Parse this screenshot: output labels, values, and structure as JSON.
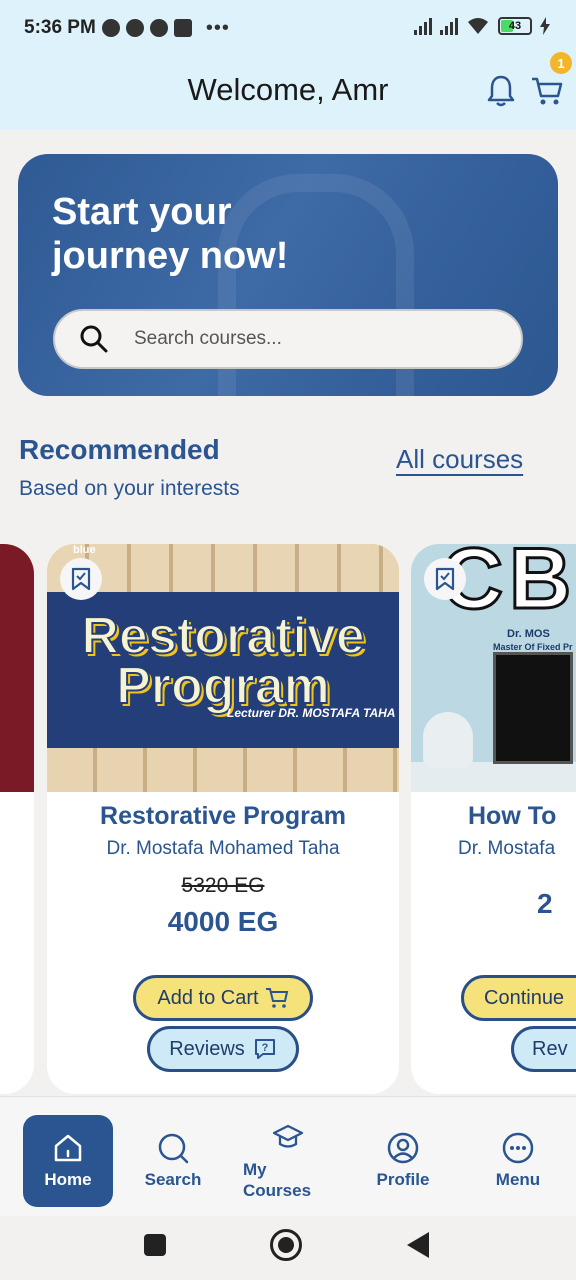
{
  "status_bar": {
    "time": "5:36 PM",
    "battery": "43"
  },
  "header": {
    "title": "Welcome, Amr",
    "cart_count": "1"
  },
  "hero": {
    "title_line1": "Start your",
    "title_line2": "journey now!",
    "search_placeholder": "Search courses..."
  },
  "recommended": {
    "title": "Recommended",
    "subtitle": "Based on your interests",
    "all_link": "All courses"
  },
  "courses": [
    {
      "title": "Restorative Program",
      "lecturer": "Dr. Mostafa Mohamed Taha",
      "old_price": "5320 EG",
      "new_price": "4000 EG",
      "cart_label": "Add to Cart",
      "reviews_label": "Reviews",
      "image_text": {
        "brand": "blue",
        "line1": "Restorative",
        "line2": "Program",
        "lecturer": "Lecturer DR. MOSTAFA TAHA"
      }
    },
    {
      "title": "How To",
      "lecturer": "Dr. Mostafa",
      "new_price": "2",
      "cart_label": "Continue",
      "reviews_label": "Rev",
      "image_text": {
        "big": "CB",
        "line1": "Dr. MOS",
        "line2": "Master Of Fixed Pr"
      }
    }
  ],
  "bottom_nav": [
    {
      "label": "Home",
      "icon": "home-icon",
      "active": true
    },
    {
      "label": "Search",
      "icon": "search-icon"
    },
    {
      "label": "My Courses",
      "icon": "graduation-cap-icon"
    },
    {
      "label": "Profile",
      "icon": "user-icon"
    },
    {
      "label": "Menu",
      "icon": "more-icon"
    }
  ],
  "colors": {
    "primary": "#2a5590",
    "header_bg": "#def2fb",
    "cart_button": "#f6e27a",
    "reviews_button": "#cfeaf7",
    "badge": "#f3b62b"
  }
}
